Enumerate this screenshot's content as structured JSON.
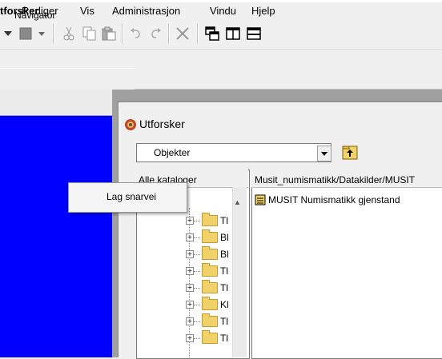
{
  "menubar": {
    "items": [
      "Rediger",
      "Vis",
      "Administrasjon",
      "Vindu",
      "Hjelp"
    ]
  },
  "toolbar": {
    "icons": [
      "dropdown-arrow-icon",
      "stop-icon",
      "dropdown-arrow-icon",
      "cut-icon",
      "copy-icon",
      "paste-icon",
      "undo-icon",
      "redo-icon",
      "delete-icon",
      "cascade-windows-icon",
      "tile-vertical-icon",
      "tile-horizontal-icon"
    ]
  },
  "left_panel": {
    "title": "tforsker",
    "tab_label": "Navigator"
  },
  "explorer": {
    "title": "Utforsker",
    "combo_value": "Objekter",
    "tree_header": "Alle kataloger",
    "tree_items": [
      "Tl",
      "Bl",
      "Bl",
      "Tl",
      "Tl",
      "Kl",
      "Tl",
      "Tl"
    ],
    "right_header": "Musit_numismatikk/Datakilder/MUSIT",
    "right_items": [
      "MUSIT Numismatikk gjenstand"
    ]
  },
  "context_menu": {
    "items": [
      "Lag snarvei"
    ]
  },
  "colors": {
    "navigator_bg": "#0000ff",
    "mdi_bg": "#a0a0a0",
    "folder": "#f1d26a"
  }
}
